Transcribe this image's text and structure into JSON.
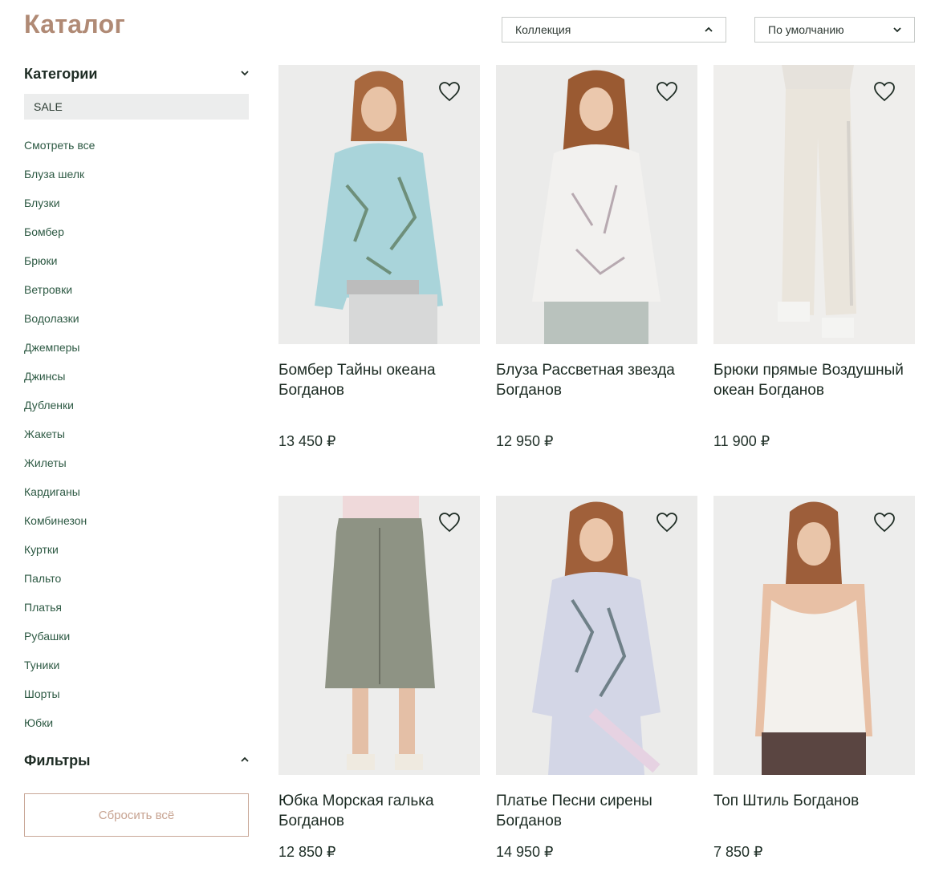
{
  "page": {
    "title": "Каталог"
  },
  "toolbar": {
    "collection": {
      "label": "Коллекция",
      "icon": "chevron-up-icon"
    },
    "sort": {
      "label": "По умолчанию",
      "icon": "chevron-down-icon"
    }
  },
  "sidebar": {
    "categories_title": "Категории",
    "sale_label": "SALE",
    "items": [
      "Смотреть все",
      "Блуза шелк",
      "Блузки",
      "Бомбер",
      "Брюки",
      "Ветровки",
      "Водолазки",
      "Джемперы",
      "Джинсы",
      "Дубленки",
      "Жакеты",
      "Жилеты",
      "Кардиганы",
      "Комбинезон",
      "Куртки",
      "Пальто",
      "Платья",
      "Рубашки",
      "Туники",
      "Шорты",
      "Юбки"
    ],
    "filters_title": "Фильтры",
    "reset_label": "Сбросить всё"
  },
  "products": [
    {
      "title": "Бомбер Тайны океана Богданов",
      "price": "13 450 ₽",
      "icon": "heart-icon"
    },
    {
      "title": "Блуза Рассветная звезда Богданов",
      "price": "12 950 ₽",
      "icon": "heart-icon"
    },
    {
      "title": "Брюки прямые Воздушный океан Богданов",
      "price": "11 900 ₽",
      "icon": "heart-icon"
    },
    {
      "title": "Юбка Морская галька Богданов",
      "price": "12 850 ₽",
      "icon": "heart-icon"
    },
    {
      "title": "Платье Песни сирены Богданов",
      "price": "14 950 ₽",
      "icon": "heart-icon"
    },
    {
      "title": "Топ Штиль Богданов",
      "price": "7 850 ₽",
      "icon": "heart-icon"
    }
  ],
  "colors": {
    "title": "#b08a75",
    "category_link": "#2e5a44",
    "reset_border": "#c9a797",
    "sale_bg": "#eceded",
    "photo_bg": "#ebebea"
  }
}
